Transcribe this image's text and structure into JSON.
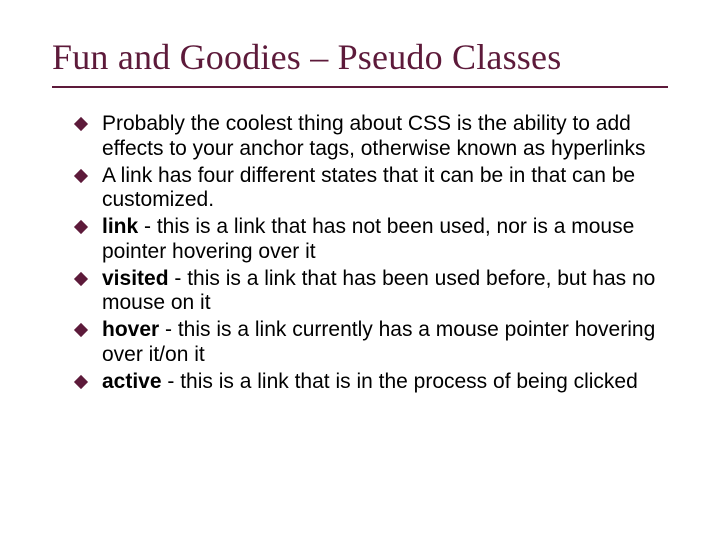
{
  "title": "Fun and Goodies – Pseudo Classes",
  "bullets": [
    {
      "text": "Probably the coolest thing about CSS is the ability to add effects to your anchor tags, otherwise known as hyperlinks"
    },
    {
      "text": "A link has four different states that it can be in that can be customized."
    },
    {
      "term": "link",
      "desc": " - this is a link that has not been used, nor is a mouse pointer hovering over it"
    },
    {
      "term": "visited",
      "desc": " - this is a link that has been used before, but has no mouse on it"
    },
    {
      "term": "hover",
      "desc": " - this is a link currently has a mouse pointer hovering over it/on it"
    },
    {
      "term": "active",
      "desc": " - this is a link that is in the process of being clicked"
    }
  ]
}
